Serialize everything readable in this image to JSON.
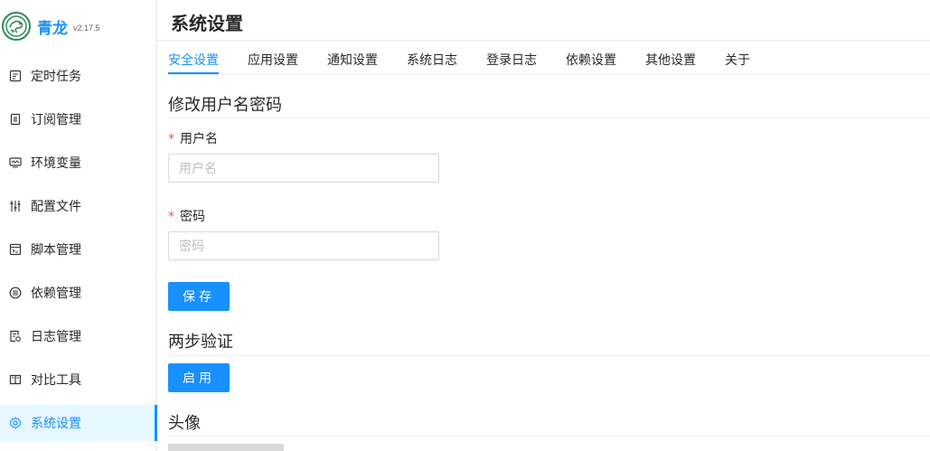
{
  "app": {
    "title": "青龙",
    "version": "v2.17.5"
  },
  "sidebar": {
    "items": [
      {
        "label": "定时任务",
        "icon": "task-icon"
      },
      {
        "label": "订阅管理",
        "icon": "subscription-icon"
      },
      {
        "label": "环境变量",
        "icon": "env-icon"
      },
      {
        "label": "配置文件",
        "icon": "config-icon"
      },
      {
        "label": "脚本管理",
        "icon": "script-icon"
      },
      {
        "label": "依赖管理",
        "icon": "dependency-icon"
      },
      {
        "label": "日志管理",
        "icon": "log-icon"
      },
      {
        "label": "对比工具",
        "icon": "diff-icon"
      },
      {
        "label": "系统设置",
        "icon": "settings-icon",
        "active": true
      }
    ]
  },
  "page": {
    "title": "系统设置"
  },
  "tabs": [
    {
      "label": "安全设置",
      "active": true
    },
    {
      "label": "应用设置"
    },
    {
      "label": "通知设置"
    },
    {
      "label": "系统日志"
    },
    {
      "label": "登录日志"
    },
    {
      "label": "依赖设置"
    },
    {
      "label": "其他设置"
    },
    {
      "label": "关于"
    }
  ],
  "security": {
    "change_credentials_title": "修改用户名密码",
    "username_label": "用户名",
    "username_placeholder": "用户名",
    "password_label": "密码",
    "password_placeholder": "密码",
    "required_mark": "*",
    "save_label": "保存",
    "two_factor_title": "两步验证",
    "enable_label": "启用",
    "avatar_title": "头像"
  },
  "colors": {
    "accent": "#1890ff",
    "active_bg": "#e6f7ff",
    "required": "#ff4d4f"
  }
}
